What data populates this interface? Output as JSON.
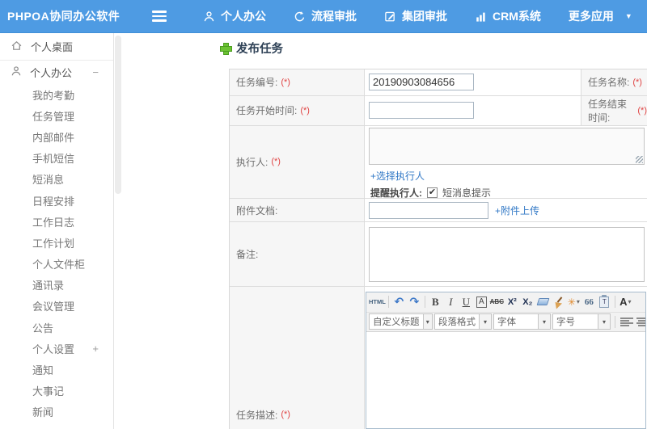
{
  "colors": {
    "header_bg": "#4e9be3",
    "link": "#3178c6",
    "required": "#e04343",
    "title": "#2e4156",
    "plus_green": "#6cc333"
  },
  "header": {
    "logo": "PHPOA协同办公软件",
    "nav": [
      {
        "label": "个人办公",
        "icon": "user-icon"
      },
      {
        "label": "流程审批",
        "icon": "process-icon"
      },
      {
        "label": "集团审批",
        "icon": "edit-square-icon"
      },
      {
        "label": "CRM系统",
        "icon": "bar-chart-icon"
      },
      {
        "label": "更多应用",
        "icon": "caret-down-icon",
        "caret": "▼"
      }
    ]
  },
  "sidebar": {
    "desktop": {
      "label": "个人桌面"
    },
    "office": {
      "label": "个人办公",
      "collapse_sign": "−"
    },
    "items": [
      {
        "label": "我的考勤"
      },
      {
        "label": "任务管理"
      },
      {
        "label": "内部邮件"
      },
      {
        "label": "手机短信"
      },
      {
        "label": "短消息"
      },
      {
        "label": "日程安排"
      },
      {
        "label": "工作日志"
      },
      {
        "label": "工作计划"
      },
      {
        "label": "个人文件柜"
      },
      {
        "label": "通讯录"
      },
      {
        "label": "会议管理"
      },
      {
        "label": "公告"
      },
      {
        "label": "个人设置",
        "expand_sign": "+"
      },
      {
        "label": "通知"
      },
      {
        "label": "大事记"
      },
      {
        "label": "新闻"
      }
    ]
  },
  "form": {
    "title": "发布任务",
    "required": "(*)",
    "task_no_label": "任务编号:",
    "task_no_value": "20190903084656",
    "task_name_label": "任务名称:",
    "start_label": "任务开始时间:",
    "end_label": "任务结束时间:",
    "executor_label": "执行人:",
    "select_executor_link": "+选择执行人",
    "remind_label": "提醒执行人:",
    "remind_checkbox": "短消息提示",
    "check_mark": "✔",
    "attach_label": "附件文档:",
    "attach_link": "+附件上传",
    "note_label": "备注:",
    "desc_label": "任务描述:"
  },
  "editor": {
    "source_button": "HTML",
    "undo_icon": "↶",
    "redo_icon": "↷",
    "bold": "B",
    "italic": "I",
    "underline": "U",
    "font_box": "A",
    "strikethrough": "ABC",
    "superscript": "X²",
    "subscript": "X₂",
    "quote": "66",
    "paste_letter": "T",
    "font_color": "A",
    "caret": "▾",
    "dropdowns": [
      {
        "label": "自定义标题"
      },
      {
        "label": "段落格式"
      },
      {
        "label": "字体"
      },
      {
        "label": "字号"
      }
    ]
  }
}
